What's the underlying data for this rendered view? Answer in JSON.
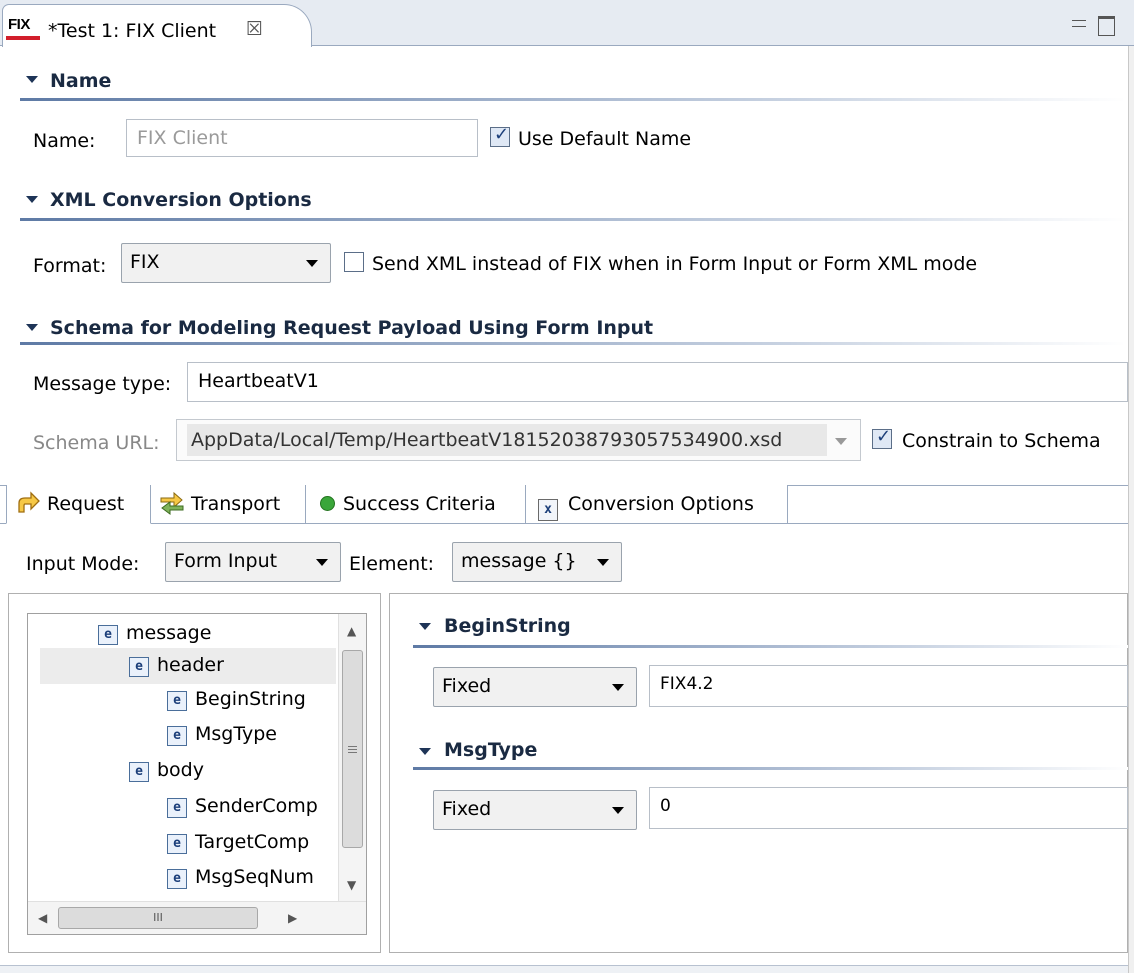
{
  "editor_tab": {
    "badge": "FIX",
    "title": "*Test 1: FIX Client",
    "close_glyph": "☒"
  },
  "name_section": {
    "title": "Name",
    "name_label": "Name:",
    "name_value": "FIX Client",
    "use_default_label": "Use Default Name",
    "use_default_checked": true
  },
  "xml_section": {
    "title": "XML Conversion Options",
    "format_label": "Format:",
    "format_value": "FIX",
    "send_xml_label": "Send XML instead of FIX when in Form Input or Form XML mode",
    "send_xml_checked": false
  },
  "schema_section": {
    "title": "Schema for Modeling Request Payload Using Form Input",
    "message_type_label": "Message type:",
    "message_type_value": "HeartbeatV1",
    "schema_url_label": "Schema URL:",
    "schema_url_value": "AppData/Local/Temp/HeartbeatV18152038793057534900.xsd",
    "constrain_label": "Constrain to Schema",
    "constrain_checked": true
  },
  "tabs": [
    {
      "label": "Request",
      "icon": "request-arrow-icon",
      "active": true
    },
    {
      "label": "Transport",
      "icon": "transport-arrows-icon"
    },
    {
      "label": "Success Criteria",
      "icon": "green-dot-icon"
    },
    {
      "label": "Conversion Options",
      "icon": "conversion-x-icon"
    }
  ],
  "request": {
    "input_mode_label": "Input Mode:",
    "input_mode_value": "Form Input",
    "element_label": "Element:",
    "element_value": "message {}"
  },
  "tree": {
    "icon_letter": "e",
    "nodes": [
      {
        "label": "message",
        "level": 0
      },
      {
        "label": "header",
        "level": 1,
        "selected": true
      },
      {
        "label": "BeginString",
        "level": 2
      },
      {
        "label": "MsgType",
        "level": 2
      },
      {
        "label": "body",
        "level": 1
      },
      {
        "label": "SenderComp",
        "level": 2
      },
      {
        "label": "TargetComp",
        "level": 2
      },
      {
        "label": "MsgSeqNum",
        "level": 2
      }
    ],
    "hscroll_thumb_glyph": "III"
  },
  "fields": [
    {
      "title": "BeginString",
      "mode": "Fixed",
      "value": "FIX4.2"
    },
    {
      "title": "MsgType",
      "mode": "Fixed",
      "value": "0"
    }
  ],
  "colors": {
    "accent": "#1e3457",
    "badge_underline": "#d21e2b",
    "success_dot": "#3aa63a"
  }
}
